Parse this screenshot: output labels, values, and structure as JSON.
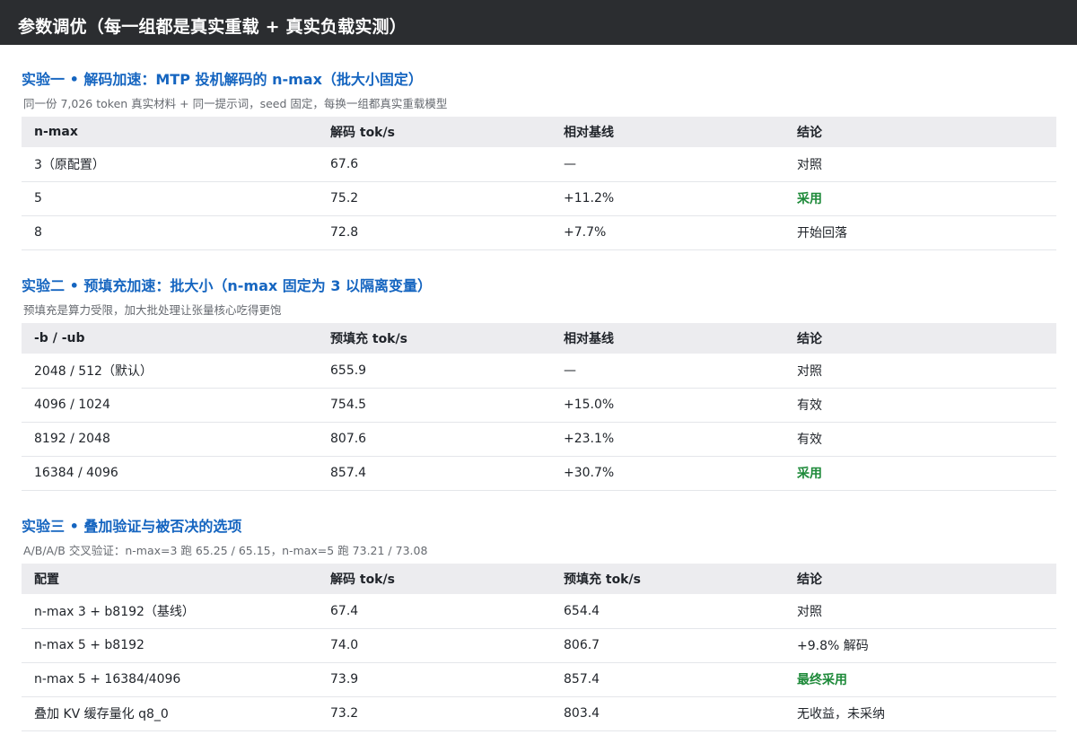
{
  "header": {
    "title": "参数调优（每一组都是真实重载 + 真实负载实测）"
  },
  "accent_color": "#1565c0",
  "adopted_color": "#1e8a3a",
  "sections": [
    {
      "title": "实验一 • 解码加速：MTP 投机解码的 n-max（批大小固定）",
      "subtitle": "同一份 7,026 token 真实材料 + 同一提示词，seed 固定，每换一组都真实重载模型",
      "columns": [
        "n-max",
        "解码 tok/s",
        "相对基线",
        "结论"
      ],
      "rows": [
        [
          "3（原配置）",
          "67.6",
          "—",
          "对照"
        ],
        [
          "5",
          "75.2",
          "+11.2%",
          "采用"
        ],
        [
          "8",
          "72.8",
          "+7.7%",
          "开始回落"
        ]
      ]
    },
    {
      "title": "实验二 • 预填充加速：批大小（n-max 固定为 3 以隔离变量）",
      "subtitle": "预填充是算力受限，加大批处理让张量核心吃得更饱",
      "columns": [
        "-b / -ub",
        "预填充 tok/s",
        "相对基线",
        "结论"
      ],
      "rows": [
        [
          "2048 / 512（默认）",
          "655.9",
          "—",
          "对照"
        ],
        [
          "4096 / 1024",
          "754.5",
          "+15.0%",
          "有效"
        ],
        [
          "8192 / 2048",
          "807.6",
          "+23.1%",
          "有效"
        ],
        [
          "16384 / 4096",
          "857.4",
          "+30.7%",
          "采用"
        ]
      ]
    },
    {
      "title": "实验三 • 叠加验证与被否决的选项",
      "subtitle": "A/B/A/B 交叉验证：n-max=3 跑 65.25 / 65.15，n-max=5 跑 73.21 / 73.08",
      "columns": [
        "配置",
        "解码 tok/s",
        "预填充 tok/s",
        "结论"
      ],
      "rows": [
        [
          "n-max 3 + b8192（基线）",
          "67.4",
          "654.4",
          "对照"
        ],
        [
          "n-max 5 + b8192",
          "74.0",
          "806.7",
          "+9.8% 解码"
        ],
        [
          "n-max 5 + 16384/4096",
          "73.9",
          "857.4",
          "最终采用"
        ],
        [
          "叠加 KV 缓存量化 q8_0",
          "73.2",
          "803.4",
          "无收益，未采纳"
        ]
      ]
    }
  ]
}
